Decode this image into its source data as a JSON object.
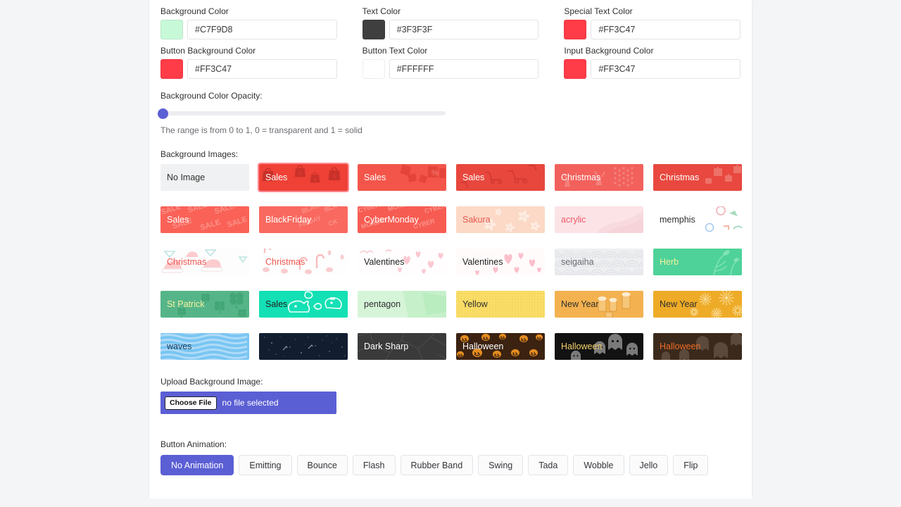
{
  "color_fields": [
    {
      "label": "Background Color",
      "value": "#C7F9D8",
      "swatch": "#C7F9D8"
    },
    {
      "label": "Text Color",
      "value": "#3F3F3F",
      "swatch": "#3F3F3F"
    },
    {
      "label": "Special Text Color",
      "value": "#FF3C47",
      "swatch": "#FF3C47"
    },
    {
      "label": "Button Background Color",
      "value": "#FF3C47",
      "swatch": "#FF3C47"
    },
    {
      "label": "Button Text Color",
      "value": "#FFFFFF",
      "swatch": "#FFFFFF"
    },
    {
      "label": "Input Background Color",
      "value": "#FF3C47",
      "swatch": "#FF3C47"
    }
  ],
  "opacity": {
    "label": "Background Color Opacity:",
    "value": "0",
    "min": "0",
    "max": "1",
    "helper": "The range is from 0 to 1, 0 = transparent and 1 = solid"
  },
  "background_images": {
    "label": "Background Images:",
    "selected_index": 1,
    "tiles": [
      {
        "name": "no-image",
        "label": "No Image",
        "bg": "#f0f1f2",
        "text_color": "#2f2f2f",
        "art": "none"
      },
      {
        "name": "sales-bags",
        "label": "Sales",
        "bg": "#ef4136",
        "text_color": "#ffffff",
        "art": "bags"
      },
      {
        "name": "sales-percent",
        "label": "Sales",
        "bg": "#f4554a",
        "text_color": "#ffffff",
        "art": "percent"
      },
      {
        "name": "sales-cart",
        "label": "Sales",
        "bg": "#e8473d",
        "text_color": "#ffffff",
        "art": "cart"
      },
      {
        "name": "christmas-deer",
        "label": "Christmas",
        "bg": "#f2615c",
        "text_color": "#ffffff",
        "art": "deer"
      },
      {
        "name": "christmas-gifts",
        "label": "Christmas",
        "bg": "#e8483f",
        "text_color": "#ffffff",
        "art": "gifts"
      },
      {
        "name": "sales-sale",
        "label": "Sales",
        "bg": "#fa6258",
        "text_color": "#ffffff",
        "art": "saletext"
      },
      {
        "name": "blackfriday",
        "label": "BlackFriday",
        "bg": "#f9695f",
        "text_color": "#ffffff",
        "art": "blackfridaytext"
      },
      {
        "name": "cybermonday",
        "label": "CyberMonday",
        "bg": "#f75c52",
        "text_color": "#ffffff",
        "art": "cybertext"
      },
      {
        "name": "sakura",
        "label": "Sakura",
        "bg": "#fbd9c6",
        "text_color": "#e8574e",
        "art": "sakura"
      },
      {
        "name": "acrylic",
        "label": "acrylic",
        "bg": "#fbe3e6",
        "text_color": "#ef5a6a",
        "art": "acrylic"
      },
      {
        "name": "memphis",
        "label": "memphis",
        "bg": "#ffffff",
        "text_color": "#2f2f2f",
        "art": "memphis"
      },
      {
        "name": "christmas-hats",
        "label": "Christmas",
        "bg": "#fdfdfd",
        "text_color": "#f0554f",
        "art": "hats"
      },
      {
        "name": "christmas-candy",
        "label": "Christmas",
        "bg": "#fefefe",
        "text_color": "#f0554f",
        "art": "candy"
      },
      {
        "name": "valentines-pink",
        "label": "Valentines",
        "bg": "#fffdfd",
        "text_color": "#1f1f1f",
        "art": "hearts-light"
      },
      {
        "name": "valentines-bold",
        "label": "Valentines",
        "bg": "#fffbfb",
        "text_color": "#1f1f1f",
        "art": "hearts-bold"
      },
      {
        "name": "seigaiha",
        "label": "seigaiha",
        "bg": "#eeeff1",
        "text_color": "#6c6c72",
        "art": "seigaiha"
      },
      {
        "name": "herb",
        "label": "Herb",
        "bg": "#4ed29a",
        "text_color": "#f3f09a",
        "art": "herb"
      },
      {
        "name": "st-patrick",
        "label": "St Patrick",
        "bg": "#55b588",
        "text_color": "#f5f2a0",
        "art": "clover"
      },
      {
        "name": "sales-piggy",
        "label": "Sales",
        "bg": "#13e0b4",
        "text_color": "#1f1f1f",
        "art": "piggy"
      },
      {
        "name": "pentagon",
        "label": "pentagon",
        "bg": "#d6f5d8",
        "text_color": "#2f2f2f",
        "art": "pentagon"
      },
      {
        "name": "yellow",
        "label": "Yellow",
        "bg": "#fadf6a",
        "text_color": "#2f2f2f",
        "art": "grid"
      },
      {
        "name": "new-year-beer",
        "label": "New Year",
        "bg": "#f3b24f",
        "text_color": "#2f2f2f",
        "art": "beer"
      },
      {
        "name": "new-year-firework",
        "label": "New Year",
        "bg": "#eeab27",
        "text_color": "#2f2f2f",
        "art": "firework"
      },
      {
        "name": "waves",
        "label": "waves",
        "bg": "#79c5f2",
        "text_color": "#1d3f5c",
        "art": "waves"
      },
      {
        "name": "night-sky",
        "label": "",
        "bg": "#121d30",
        "text_color": "#ffffff",
        "art": "stars"
      },
      {
        "name": "dark-sharp",
        "label": "Dark Sharp",
        "bg": "#3a3a3a",
        "text_color": "#ffffff",
        "art": "sharp"
      },
      {
        "name": "halloween-pumpkin",
        "label": "Halloween",
        "bg": "#3b2211",
        "text_color": "#ffffff",
        "art": "pumpkin"
      },
      {
        "name": "halloween-ghost",
        "label": "Halloween",
        "bg": "#121212",
        "text_color": "#f3cf6a",
        "art": "ghost"
      },
      {
        "name": "halloween-brown",
        "label": "Halloween",
        "bg": "#3b2a1c",
        "text_color": "#ef6a28",
        "art": "ghost-brown"
      }
    ]
  },
  "upload": {
    "label": "Upload Background Image:",
    "button_label": "Choose File",
    "status": "no file selected"
  },
  "button_animation": {
    "label": "Button Animation:",
    "selected": "No Animation",
    "options": [
      "No Animation",
      "Emitting",
      "Bounce",
      "Flash",
      "Rubber Band",
      "Swing",
      "Tada",
      "Wobble",
      "Jello",
      "Flip"
    ]
  }
}
